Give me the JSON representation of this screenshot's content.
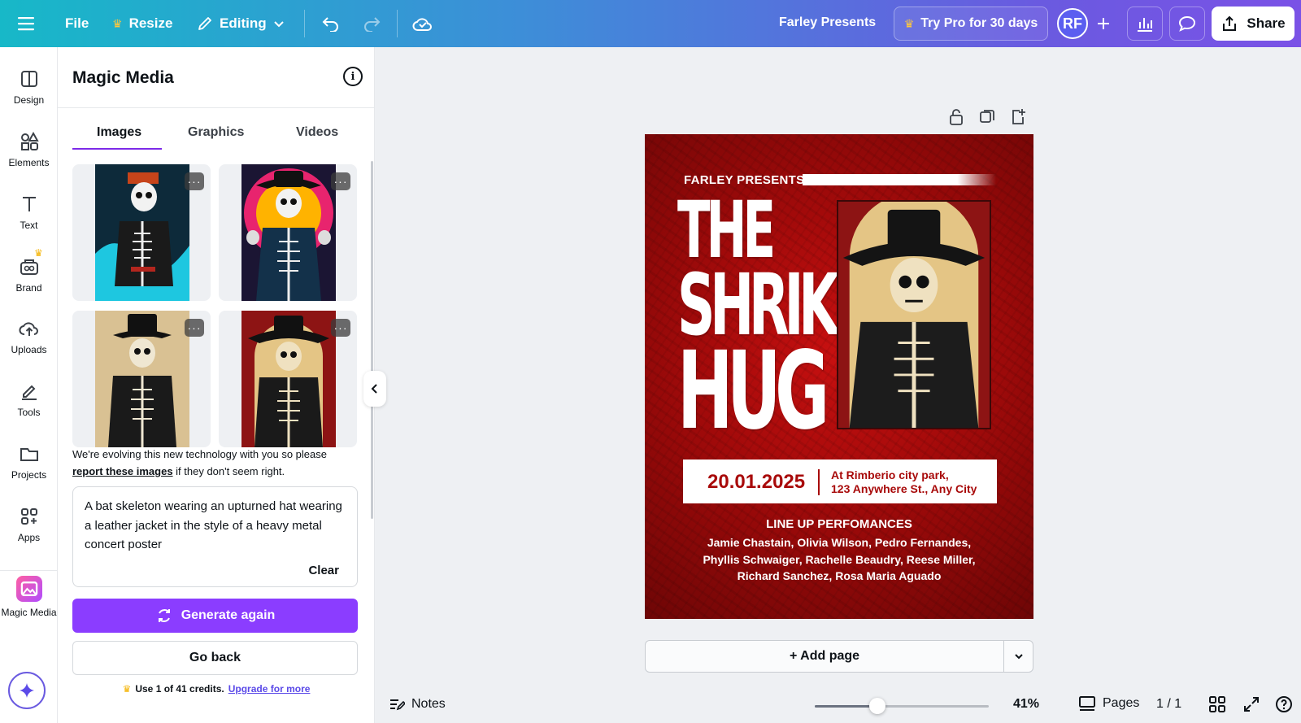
{
  "topbar": {
    "file_label": "File",
    "resize_label": "Resize",
    "editing_label": "Editing",
    "project_title": "Farley Presents",
    "try_pro_label": "Try Pro for 30 days",
    "avatar_initials": "RF",
    "share_label": "Share"
  },
  "rail": {
    "items": [
      {
        "label": "Design",
        "icon": "design-icon"
      },
      {
        "label": "Elements",
        "icon": "elements-icon"
      },
      {
        "label": "Text",
        "icon": "text-icon"
      },
      {
        "label": "Brand",
        "icon": "brand-icon"
      },
      {
        "label": "Uploads",
        "icon": "uploads-icon"
      },
      {
        "label": "Tools",
        "icon": "tools-icon"
      },
      {
        "label": "Projects",
        "icon": "projects-icon"
      },
      {
        "label": "Apps",
        "icon": "apps-icon"
      },
      {
        "label": "Magic Media",
        "icon": "magic-media-icon"
      }
    ]
  },
  "panel": {
    "title": "Magic Media",
    "tabs": [
      "Images",
      "Graphics",
      "Videos"
    ],
    "active_tab": "Images",
    "note_prefix": "We're evolving this new technology with you so please ",
    "note_link": "report these images",
    "note_suffix": " if they don't seem right.",
    "prompt_text": "A bat skeleton wearing an upturned hat wearing a leather jacket in the style of a heavy metal concert poster",
    "clear_label": "Clear",
    "generate_label": "Generate again",
    "back_label": "Go back",
    "credits_text": "Use 1 of 41 credits.",
    "credits_link": "Upgrade for more",
    "more_label": "···"
  },
  "poster": {
    "presents": "FARLEY PRESENTS",
    "title_lines": [
      "THE",
      "SHRIKE",
      "HUG"
    ],
    "date": "20.01.2025",
    "location_line1": "At Rimberio city park,",
    "location_line2": "123 Anywhere St., Any City",
    "lineup_title": "LINE UP PERFOMANCES",
    "names_line1": "Jamie Chastain, Olivia Wilson, Pedro Fernandes,",
    "names_line2": "Phyllis Schwaiger, Rachelle Beaudry, Reese Miller,",
    "names_line3": "Richard Sanchez, Rosa Maria Aguado"
  },
  "canvas": {
    "add_page_label": "+ Add page"
  },
  "bottombar": {
    "notes_label": "Notes",
    "zoom": "41%",
    "zoom_fraction": 0.36,
    "pages_label": "Pages",
    "page_count": "1 / 1"
  },
  "colors": {
    "accent": "#8b3dff",
    "poster_red": "#a80a0a"
  }
}
